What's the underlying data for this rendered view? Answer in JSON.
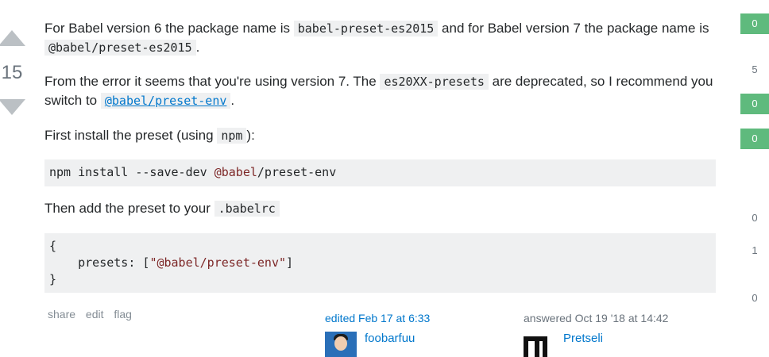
{
  "vote": {
    "count": "15"
  },
  "answer": {
    "p1": {
      "a": "For Babel version 6 the package name is ",
      "code1": "babel-preset-es2015",
      "b": " and for Babel version 7 the package name is ",
      "code2": "@babel/preset-es2015",
      "c": "."
    },
    "p2": {
      "a": "From the error it seems that you're using version 7. The ",
      "code1": "es20XX-presets",
      "b": " are deprecated, so I recommend you switch to ",
      "link": "@babel/preset-env",
      "c": "."
    },
    "p3": {
      "a": "First install the preset (using ",
      "code1": "npm",
      "b": "):"
    },
    "pre1": {
      "a": "npm install --save-dev ",
      "b": "@babel",
      "c": "/preset-env"
    },
    "p4": {
      "a": "Then add the preset to your ",
      "code1": ".babelrc"
    },
    "pre2": {
      "l1": "{",
      "l2a": "    presets: [",
      "l2b": "\"@babel/preset-env\"",
      "l2c": "]",
      "l3": "}"
    }
  },
  "menu": {
    "share": "share",
    "edit": "edit",
    "flag": "flag"
  },
  "edited": {
    "label": "edited Feb 17 at 6:33",
    "user": "foobarfuu"
  },
  "answered": {
    "label": "answered Oct 19 '18 at 14:42",
    "user": "Pretseli"
  },
  "comment_votes": [
    "0",
    "5",
    "0",
    "0",
    "0",
    "1",
    "0"
  ],
  "colors": {
    "accent": "#0077cc",
    "badge_green": "#5fba7d",
    "code_bg": "#eff0f1"
  }
}
